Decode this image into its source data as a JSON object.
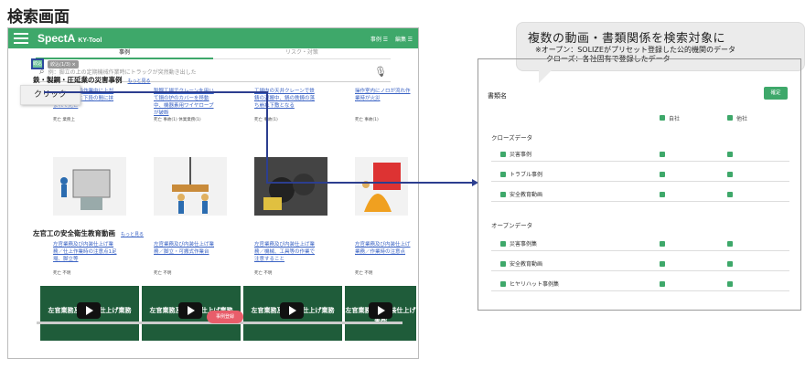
{
  "page_title": "検索画面",
  "app": {
    "brand": "SpectA",
    "brand_sub": "KY-Tool",
    "right_items": [
      "事例 ☰",
      "編集 ☰"
    ],
    "tabs": [
      "事例",
      "リスク・対策"
    ],
    "search_placeholder": "例：脚立の上の定期機械作業時にトラックが突然動き出した",
    "filter_label": "絞込",
    "filter_tag": "絞込(1/3) ×",
    "sec1": {
      "title": "鉄・製鋼・圧延業の災害事例",
      "more": "もっと見る"
    },
    "cases": [
      {
        "text": "2t入りの変換作業中に上がりし、上がと下段の間に挟まれて死亡",
        "meta": "死亡  業務上"
      },
      {
        "text": "製鋼工場でクレーンを用いて鍋の炉のカバーを移動中、機器素用ワイヤロープが破断",
        "meta": "死亡  事故(1)  休業業務(1)"
      },
      {
        "text": "工場内の天井クレーンで鉄鋳の運搬中、鍋の鉄鋳の落ち崩れ下敷となる",
        "meta": "死亡  事故(1)"
      },
      {
        "text": "操作室内にノロが流れ作業時が火災",
        "meta": "死亡  事故(1)"
      }
    ],
    "sec2": {
      "title": "左官工の安全衛生教育動画",
      "more": "もっと見る"
    },
    "videos": [
      {
        "text": "左官業務及び内装仕上げ業務／仕上作業時の注意点1足場、脚立等",
        "meta": "死亡  不明"
      },
      {
        "text": "左官業務及び内装仕上げ業務／脚立・可搬式作業台",
        "meta": "死亡  不明"
      },
      {
        "text": "左官業務及び内装仕上げ業務／機械、工具等の作業で注意すること",
        "meta": "死亡  不明"
      },
      {
        "text": "左官業務及び内装仕上げ業務／作業時の注意点",
        "meta": "死亡  不明"
      }
    ],
    "video_caption": "左官業務及び内装仕上げ業務",
    "case_pill": "事例登録"
  },
  "click_label": "クリック",
  "callout": {
    "title": "複数の動画・書類関係を検索対象に",
    "line1": "※オープン：SOLIZEがプリセット登録した公的機関のデータ",
    "line2": "クローズ：各社固有で登録したデータ"
  },
  "panel": {
    "title": "書類名",
    "confirm": "確定",
    "col1": "自社",
    "col2": "他社",
    "closed_group": "クローズデータ",
    "closed": [
      "災害事例",
      "トラブル事例",
      "安全教育動画"
    ],
    "open_group": "オープンデータ",
    "open": [
      "災害事例集",
      "安全教育動画",
      "ヒヤリハット事例集"
    ]
  }
}
